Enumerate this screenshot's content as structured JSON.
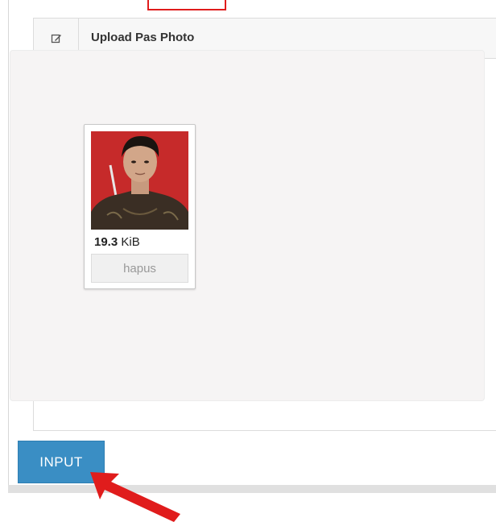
{
  "panel": {
    "title": "Upload Pas Photo",
    "icon": "edit-icon"
  },
  "photo_card": {
    "size_number": "19.3",
    "size_unit": " KiB",
    "delete_label": "hapus"
  },
  "actions": {
    "input_label": "INPUT"
  },
  "colors": {
    "accent": "#3a8ec4",
    "annotation": "#e01c1c",
    "photo_background": "#c62a2a"
  }
}
